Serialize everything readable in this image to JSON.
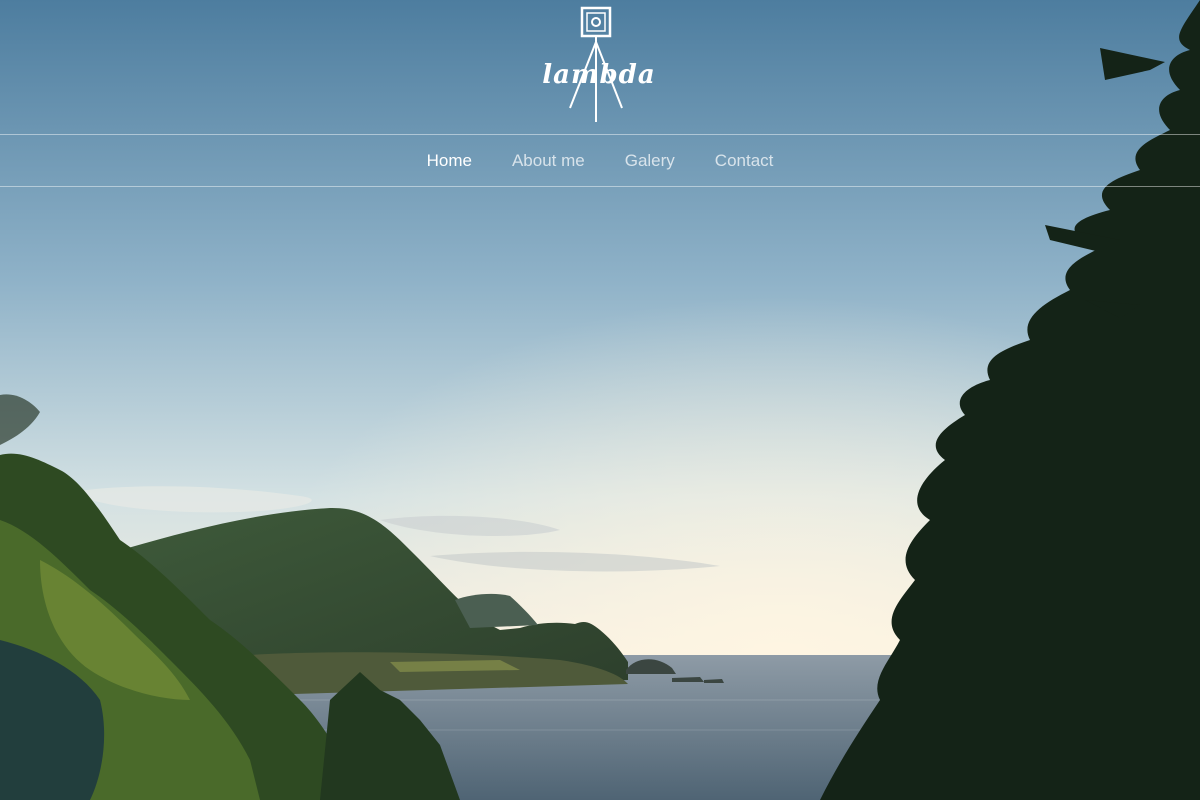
{
  "brand": {
    "name": "lambda",
    "icon": "camera-tripod-icon"
  },
  "nav": {
    "items": [
      {
        "label": "Home",
        "active": true
      },
      {
        "label": "About me",
        "active": false
      },
      {
        "label": "Galery",
        "active": false
      },
      {
        "label": "Contact",
        "active": false
      }
    ]
  },
  "colors": {
    "sky_top": "#4f7fa0",
    "sky_mid": "#b7cfd9",
    "sky_horizon": "#f6eedd",
    "sea": "#6b7f8f",
    "nav_text": "#ffffff"
  }
}
